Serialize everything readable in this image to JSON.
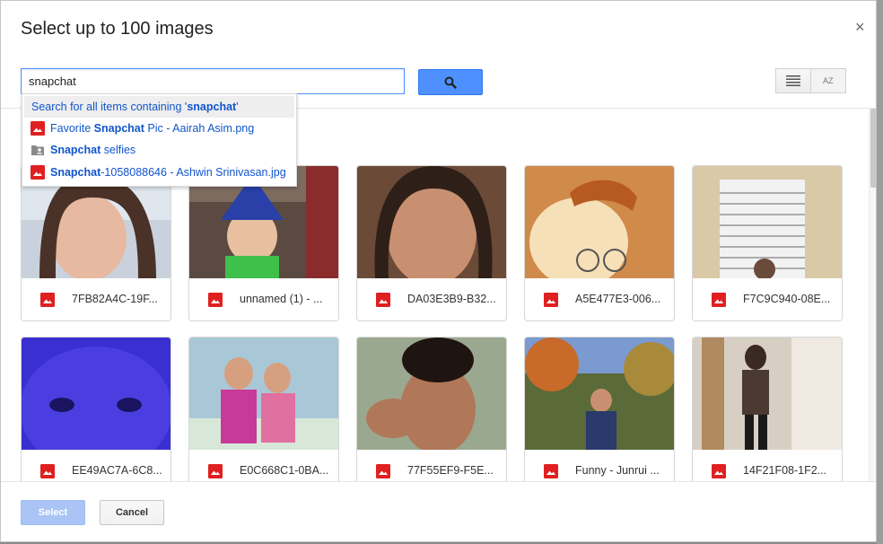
{
  "dialog": {
    "title": "Select up to 100 images",
    "close_label": "×"
  },
  "search": {
    "query": "snapchat",
    "button_icon": "search-icon"
  },
  "view_controls": {
    "list_icon": "list-view-icon",
    "sort_icon": "sort-az-icon",
    "sort_label": "AZ"
  },
  "suggestions": {
    "search_all_prefix": "Search for all items containing '",
    "search_all_term": "snapchat",
    "search_all_suffix": "'",
    "items": [
      {
        "icon": "image-file-icon",
        "before": "Favorite ",
        "match": "Snapchat",
        "after": " Pic - Aairah Asim.png"
      },
      {
        "icon": "shared-folder-icon",
        "before": "",
        "match": "Snapchat",
        "after": " selfies"
      },
      {
        "icon": "image-file-icon",
        "before": "",
        "match": "Snapchat",
        "after": "-1058088646 - Ashwin Srinivasan.jpg"
      }
    ]
  },
  "images": [
    {
      "name": "7FB82A4C-19F...",
      "icon": "image-file-icon",
      "accent": "#b9c3cf"
    },
    {
      "name": "unnamed (1) - ...",
      "icon": "image-file-icon",
      "accent": "#3b4a8c"
    },
    {
      "name": "DA03E3B9-B32...",
      "icon": "image-file-icon",
      "accent": "#8c5a3c"
    },
    {
      "name": "A5E477E3-006...",
      "icon": "image-file-icon",
      "accent": "#e0a060"
    },
    {
      "name": "F7C9C940-08E...",
      "icon": "image-file-icon",
      "accent": "#d9c9a8"
    },
    {
      "name": "EE49AC7A-6C8...",
      "icon": "image-file-icon",
      "accent": "#3a2fd0"
    },
    {
      "name": "E0C668C1-0BA...",
      "icon": "image-file-icon",
      "accent": "#a9c8d8"
    },
    {
      "name": "77F55EF9-F5E...",
      "icon": "image-file-icon",
      "accent": "#9aa890"
    },
    {
      "name": "Funny - Junrui ...",
      "icon": "image-file-icon",
      "accent": "#7a8a4a"
    },
    {
      "name": "14F21F08-1F2...",
      "icon": "image-file-icon",
      "accent": "#c9a070"
    }
  ],
  "footer": {
    "select_label": "Select",
    "cancel_label": "Cancel"
  },
  "colors": {
    "accent_blue": "#4d90fe",
    "link_blue": "#1155cc",
    "file_red": "#e02020"
  }
}
